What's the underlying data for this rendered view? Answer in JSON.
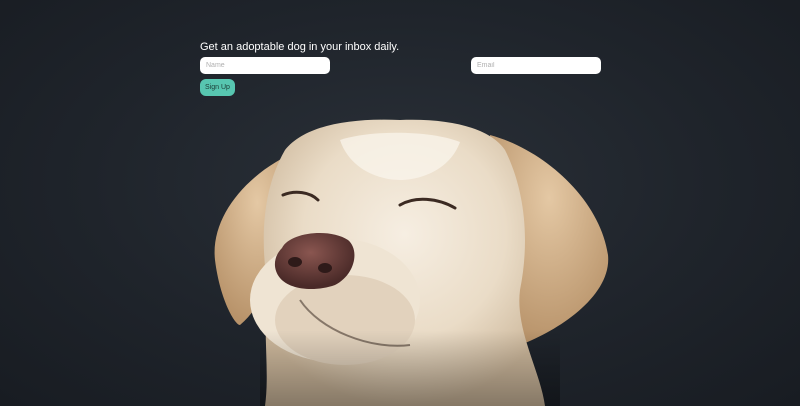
{
  "signup": {
    "heading": "Get an adoptable dog in your inbox daily.",
    "name_placeholder": "Name",
    "email_placeholder": "Email",
    "button_label": "Sign Up"
  },
  "colors": {
    "background": "#1f242b",
    "button": "#57c6b0",
    "dog_fur": "#f1e6d6",
    "dog_ear": "#d6b48f",
    "dog_nose": "#5a3431"
  },
  "hero_image": "dog-photo"
}
